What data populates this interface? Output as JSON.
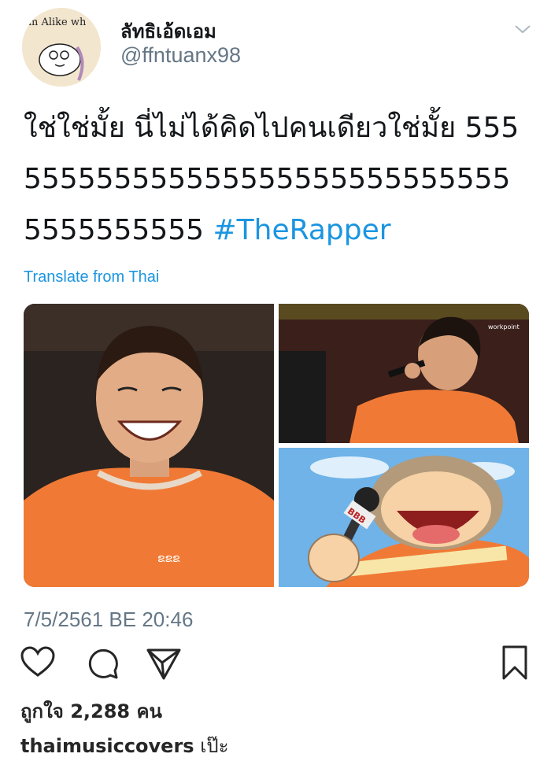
{
  "tweet": {
    "avatar_text": "m Alike wh",
    "display_name": "ลัทธิเอ้ดเอม",
    "handle": "@ffntuanx98",
    "text": "ใช่ใช่มั้ย นี่ไม่ได้คิดไปคนเดียวใช่มั้ย 5555555555555555555555555555555555555555 ",
    "hashtag": "#TheRapper",
    "translate": "Translate from Thai",
    "media": [
      {
        "icon": "person-laughing-photo"
      },
      {
        "icon": "person-with-microphone-photo",
        "watermark": "workpoint"
      },
      {
        "icon": "cartoon-character-photo",
        "mic_text": "BBB"
      }
    ],
    "timestamp": "7/5/2561 BE 20:46"
  },
  "instagram": {
    "actions": [
      "heart-icon",
      "comment-icon",
      "share-icon",
      "bookmark-icon"
    ],
    "likes": "ถูกใจ 2,288 คน",
    "caption_user": "thaimusiccovers",
    "caption_text": "เป๊ะ"
  },
  "colors": {
    "link": "#1b95e0",
    "secondary": "#657786",
    "shirt": "#f07a35"
  }
}
